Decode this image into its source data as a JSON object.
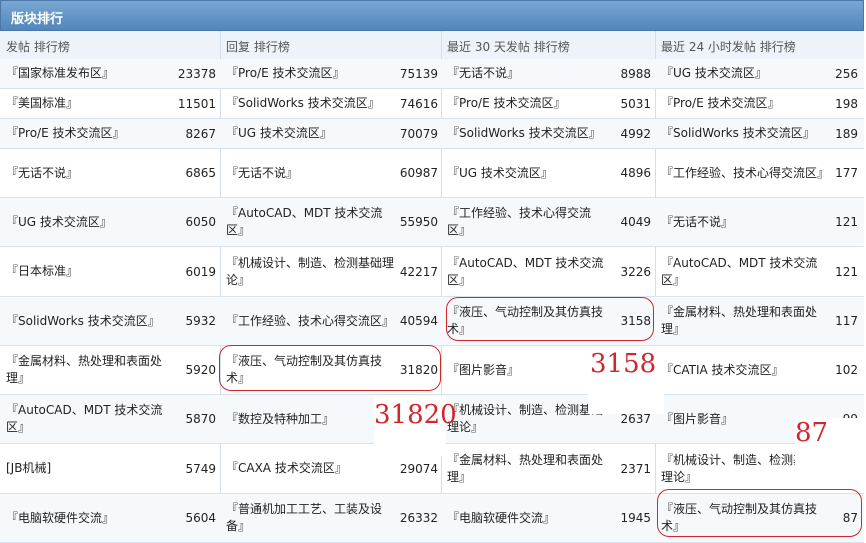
{
  "panel_title": "版块排行",
  "columns": [
    {
      "label": "发帖 排行榜"
    },
    {
      "label": "回复 排行榜"
    },
    {
      "label": "最近 30 天发帖 排行榜"
    },
    {
      "label": "最近 24 小时发帖 排行榜"
    }
  ],
  "rows": [
    {
      "c1n": "『国家标准发布区』",
      "c1c": "23378",
      "c2n": "『Pro/E 技术交流区』",
      "c2c": "75139",
      "c3n": "『无话不说』",
      "c3c": "8988",
      "c4n": "『UG 技术交流区』",
      "c4c": "256"
    },
    {
      "c1n": "『美国标准』",
      "c1c": "11501",
      "c2n": "『SolidWorks 技术交流区』",
      "c2c": "74616",
      "c3n": "『Pro/E 技术交流区』",
      "c3c": "5031",
      "c4n": "『Pro/E 技术交流区』",
      "c4c": "198"
    },
    {
      "c1n": "『Pro/E 技术交流区』",
      "c1c": "8267",
      "c2n": "『UG 技术交流区』",
      "c2c": "70079",
      "c3n": "『SolidWorks 技术交流区』",
      "c3c": "4992",
      "c4n": "『SolidWorks 技术交流区』",
      "c4c": "189"
    },
    {
      "c1n": "『无话不说』",
      "c1c": "6865",
      "c2n": "『无话不说』",
      "c2c": "60987",
      "c3n": "『UG 技术交流区』",
      "c3c": "4896",
      "c4n": "『工作经验、技术心得交流区』",
      "c4c": "177"
    },
    {
      "c1n": "『UG 技术交流区』",
      "c1c": "6050",
      "c2n": "『AutoCAD、MDT 技术交流区』",
      "c2c": "55950",
      "c3n": "『工作经验、技术心得交流区』",
      "c3c": "4049",
      "c4n": "『无话不说』",
      "c4c": "121"
    },
    {
      "c1n": "『日本标准』",
      "c1c": "6019",
      "c2n": "『机械设计、制造、检测基础理论』",
      "c2c": "42217",
      "c3n": "『AutoCAD、MDT 技术交流区』",
      "c3c": "3226",
      "c4n": "『AutoCAD、MDT 技术交流区』",
      "c4c": "121"
    },
    {
      "c1n": "『SolidWorks 技术交流区』",
      "c1c": "5932",
      "c2n": "『工作经验、技术心得交流区』",
      "c2c": "40594",
      "c3n": "『液压、气动控制及其仿真技术』",
      "c3c": "3158",
      "c4n": "『金属材料、热处理和表面处理』",
      "c4c": "117"
    },
    {
      "c1n": "『金属材料、热处理和表面处理』",
      "c1c": "5920",
      "c2n": "『液压、气动控制及其仿真技术』",
      "c2c": "31820",
      "c3n": "『图片影音』",
      "c3c": "",
      "c4n": "『CATIA 技术交流区』",
      "c4c": "102"
    },
    {
      "c1n": "『AutoCAD、MDT 技术交流区』",
      "c1c": "5870",
      "c2n": "『数控及特种加工』",
      "c2c": "",
      "c3n": "『机械设计、制造、检测基础理论』",
      "c3c": "2637",
      "c4n": "『图片影音』",
      "c4c": "99"
    },
    {
      "c1n": "[JB机械]",
      "c1c": "5749",
      "c2n": "『CAXA 技术交流区』",
      "c2c": "29074",
      "c3n": "『金属材料、热处理和表面处理』",
      "c3c": "2371",
      "c4n": "『机械设计、制造、检测基础理论』",
      "c4c": ""
    },
    {
      "c1n": "『电脑软硬件交流』",
      "c1c": "5604",
      "c2n": "『普通机加工工艺、工装及设备』",
      "c2c": "26332",
      "c3n": "『电脑软硬件交流』",
      "c3c": "1945",
      "c4n": "『液压、气动控制及其仿真技术』",
      "c4c": "87"
    }
  ],
  "annotations": {
    "a1": "31820",
    "a2": "3158",
    "a3": "87"
  },
  "colors": {
    "accent": "#d0262c",
    "title_bg": "#5286bd",
    "header_bg": "#eef3f9"
  }
}
